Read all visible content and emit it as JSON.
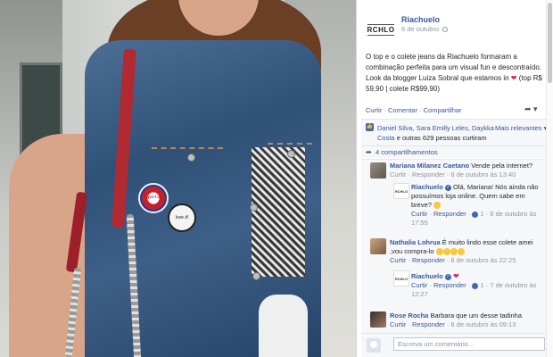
{
  "photo": {
    "pin_left_text": "Pepsi-Cola",
    "pin_right_text": "love it!"
  },
  "post": {
    "page_name": "Riachuelo",
    "logo_text": "RCHLO",
    "date": "6 de outubro",
    "text": "O top e o colete jeans da Riachuelo formaram a combinação perfeita para um visual fun e descontraído. Look da blogger Luiza Sobral que estamos in",
    "text_tail": "(top R$ 59,90 | colete R$99,90)",
    "actions": {
      "like": "Curtir",
      "comment": "Comentar",
      "share": "Compartilhar"
    },
    "likes": {
      "names": "Daniel Silva, Sara Emilly Leles,",
      "names2": "Daykka Costa",
      "rest": "e outras 629 pessoas curtiram isso.",
      "relevant": "Mais relevantes"
    },
    "shares": "4 compartilhamentos"
  },
  "comments": [
    {
      "author": "Mariana Milanez Caetano",
      "text": "Vende pela internet?",
      "meta": "Curtir · Responder · 6 de outubro às 13:40"
    },
    {
      "author": "Riachuelo",
      "text": "Olá, Mariana! Nós ainda não possuímos loja online. Quem sabe em breve?",
      "like_label": "Curtir",
      "reply_label": "Responder",
      "likes": "1",
      "meta_date": "6 de outubro às 17:55"
    },
    {
      "author": "Nathalia Lohrua",
      "text": "É muito lindo esse colete amei ,vou compra-lo",
      "like_label": "Curtir",
      "reply_label": "Responder",
      "meta_date": "6 de outubro às 22:25"
    },
    {
      "author": "Riachuelo",
      "like_label": "Curtir",
      "reply_label": "Responder",
      "likes": "1",
      "meta_date": "7 de outubro às 12:27"
    },
    {
      "author": "Rose Rocha",
      "text": "Barbara que um desse tadinha",
      "like_label": "Curtir",
      "reply_label": "Responder",
      "meta_date": "6 de outubro às 09:13"
    }
  ],
  "composer": {
    "placeholder": "Escreva um comentário..."
  }
}
